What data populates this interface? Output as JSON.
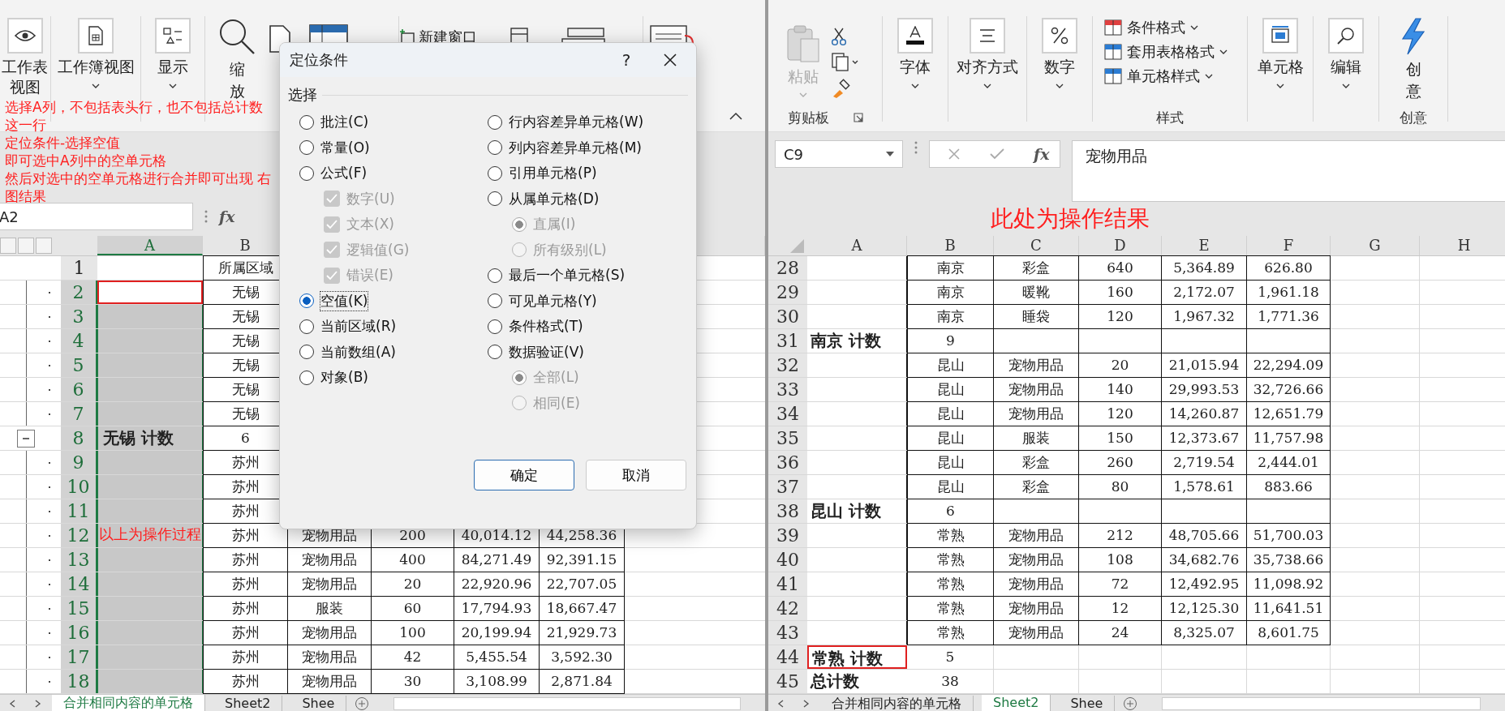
{
  "left_pane": {
    "ribbon": {
      "sheet_view": "工作表视图",
      "workbook_view": "工作簿视图",
      "show": "显示",
      "zoom": "缩放",
      "new_window": "新建窗口"
    },
    "name_box": "A2",
    "fx": "fx",
    "sheet": {
      "columns": [
        "A",
        "B"
      ],
      "rows": [
        {
          "number": "1",
          "kind": "header",
          "selected": false,
          "outlined": false,
          "cells": [
            "",
            "所属区域"
          ]
        },
        {
          "number": "2",
          "kind": "data",
          "selected": true,
          "outlined": true,
          "cells": [
            "",
            "无锡"
          ]
        },
        {
          "number": "3",
          "kind": "data",
          "selected": true,
          "outlined": false,
          "cells": [
            "",
            "无锡"
          ]
        },
        {
          "number": "4",
          "kind": "data",
          "selected": true,
          "outlined": false,
          "cells": [
            "",
            "无锡"
          ]
        },
        {
          "number": "5",
          "kind": "data",
          "selected": true,
          "outlined": false,
          "cells": [
            "",
            "无锡"
          ]
        },
        {
          "number": "6",
          "kind": "data",
          "selected": true,
          "outlined": false,
          "cells": [
            "",
            "无锡"
          ]
        },
        {
          "number": "7",
          "kind": "data",
          "selected": true,
          "outlined": false,
          "cells": [
            "",
            "无锡"
          ]
        },
        {
          "number": "8",
          "kind": "subtotal",
          "selected": true,
          "outlined": false,
          "cells": [
            "无锡 计数",
            "6"
          ]
        },
        {
          "number": "9",
          "kind": "data",
          "selected": true,
          "outlined": false,
          "cells": [
            "",
            "苏州"
          ]
        },
        {
          "number": "10",
          "kind": "data",
          "selected": true,
          "outlined": false,
          "cells": [
            "",
            "苏州"
          ]
        },
        {
          "number": "11",
          "kind": "data",
          "selected": true,
          "outlined": false,
          "cells": [
            "",
            "苏州"
          ]
        },
        {
          "number": "12",
          "kind": "data",
          "selected": true,
          "outlined": false,
          "cells": [
            "",
            "苏州",
            "宠物用品",
            "200",
            "40,014.12",
            "44,258.36"
          ]
        },
        {
          "number": "13",
          "kind": "data",
          "selected": true,
          "outlined": false,
          "cells": [
            "",
            "苏州",
            "宠物用品",
            "400",
            "84,271.49",
            "92,391.15"
          ]
        },
        {
          "number": "14",
          "kind": "data",
          "selected": true,
          "outlined": false,
          "cells": [
            "",
            "苏州",
            "宠物用品",
            "20",
            "22,920.96",
            "22,707.05"
          ]
        },
        {
          "number": "15",
          "kind": "data",
          "selected": true,
          "outlined": false,
          "cells": [
            "",
            "苏州",
            "服装",
            "60",
            "17,794.93",
            "18,667.47"
          ]
        },
        {
          "number": "16",
          "kind": "data",
          "selected": true,
          "outlined": false,
          "cells": [
            "",
            "苏州",
            "宠物用品",
            "100",
            "20,199.94",
            "21,929.73"
          ]
        },
        {
          "number": "17",
          "kind": "data",
          "selected": true,
          "outlined": false,
          "cells": [
            "",
            "苏州",
            "宠物用品",
            "42",
            "5,455.54",
            "3,592.30"
          ]
        },
        {
          "number": "18",
          "kind": "data",
          "selected": true,
          "outlined": false,
          "cells": [
            "",
            "苏州",
            "宠物用品",
            "30",
            "3,108.99",
            "2,871.84"
          ]
        }
      ]
    },
    "sheet_tabs": [
      {
        "label": "合并相同内容的单元格",
        "selected": true
      },
      {
        "label": "Sheet2",
        "selected": false
      },
      {
        "label": "Shee",
        "selected": false
      }
    ]
  },
  "right_pane": {
    "ribbon": {
      "paste": "粘贴",
      "clipboard_group": "剪贴板",
      "font": "字体",
      "alignment": "对齐方式",
      "number": "数字",
      "styles": [
        "条件格式",
        "套用表格格式",
        "单元格样式"
      ],
      "styles_group": "样式",
      "cells": "单元格",
      "editing": "编辑",
      "ideas": "创意",
      "ideas_group": "创意"
    },
    "name_box": "C9",
    "fx": "fx",
    "formula": "宠物用品",
    "sheet": {
      "columns": [
        "A",
        "B",
        "C",
        "D",
        "E",
        "F",
        "G",
        "H"
      ],
      "rows": [
        {
          "number": "28",
          "kind": "data",
          "in_table": true,
          "outlined": false,
          "cells": [
            "",
            "南京",
            "彩盒",
            "640",
            "5,364.89",
            "626.80"
          ]
        },
        {
          "number": "29",
          "kind": "data",
          "in_table": true,
          "outlined": false,
          "cells": [
            "",
            "南京",
            "暖靴",
            "160",
            "2,172.07",
            "1,961.18"
          ]
        },
        {
          "number": "30",
          "kind": "data",
          "in_table": true,
          "outlined": false,
          "cells": [
            "",
            "南京",
            "睡袋",
            "120",
            "1,967.32",
            "1,771.36"
          ]
        },
        {
          "number": "31",
          "kind": "subtotal",
          "in_table": true,
          "outlined": false,
          "cells": [
            "南京 计数",
            "9",
            "",
            "",
            "",
            ""
          ]
        },
        {
          "number": "32",
          "kind": "data",
          "in_table": true,
          "outlined": false,
          "cells": [
            "",
            "昆山",
            "宠物用品",
            "20",
            "21,015.94",
            "22,294.09"
          ]
        },
        {
          "number": "33",
          "kind": "data",
          "in_table": true,
          "outlined": false,
          "cells": [
            "",
            "昆山",
            "宠物用品",
            "140",
            "29,993.53",
            "32,726.66"
          ]
        },
        {
          "number": "34",
          "kind": "data",
          "in_table": true,
          "outlined": false,
          "cells": [
            "",
            "昆山",
            "宠物用品",
            "120",
            "14,260.87",
            "12,651.79"
          ]
        },
        {
          "number": "35",
          "kind": "data",
          "in_table": true,
          "outlined": false,
          "cells": [
            "",
            "昆山",
            "服装",
            "150",
            "12,373.67",
            "11,757.98"
          ]
        },
        {
          "number": "36",
          "kind": "data",
          "in_table": true,
          "outlined": false,
          "cells": [
            "",
            "昆山",
            "彩盒",
            "260",
            "2,719.54",
            "2,444.01"
          ]
        },
        {
          "number": "37",
          "kind": "data",
          "in_table": true,
          "outlined": false,
          "cells": [
            "",
            "昆山",
            "彩盒",
            "80",
            "1,578.61",
            "883.66"
          ]
        },
        {
          "number": "38",
          "kind": "subtotal",
          "in_table": true,
          "outlined": false,
          "cells": [
            "昆山 计数",
            "6",
            "",
            "",
            "",
            ""
          ]
        },
        {
          "number": "39",
          "kind": "data",
          "in_table": true,
          "outlined": false,
          "cells": [
            "",
            "常熟",
            "宠物用品",
            "212",
            "48,705.66",
            "51,700.03"
          ]
        },
        {
          "number": "40",
          "kind": "data",
          "in_table": true,
          "outlined": false,
          "cells": [
            "",
            "常熟",
            "宠物用品",
            "108",
            "34,682.76",
            "35,738.66"
          ]
        },
        {
          "number": "41",
          "kind": "data",
          "in_table": true,
          "outlined": false,
          "cells": [
            "",
            "常熟",
            "宠物用品",
            "72",
            "12,492.95",
            "11,098.92"
          ]
        },
        {
          "number": "42",
          "kind": "data",
          "in_table": true,
          "outlined": false,
          "cells": [
            "",
            "常熟",
            "宠物用品",
            "12",
            "12,125.30",
            "11,641.51"
          ]
        },
        {
          "number": "43",
          "kind": "data",
          "in_table": true,
          "outlined": false,
          "cells": [
            "",
            "常熟",
            "宠物用品",
            "24",
            "8,325.07",
            "8,601.75"
          ]
        },
        {
          "number": "44",
          "kind": "subtotal",
          "in_table": false,
          "outlined": true,
          "cells": [
            "常熟 计数",
            "5"
          ]
        },
        {
          "number": "45",
          "kind": "subtotal",
          "in_table": false,
          "outlined": false,
          "cells": [
            "总计数",
            "38"
          ]
        }
      ]
    },
    "sheet_tabs": [
      {
        "label": "合并相同内容的单元格",
        "selected": false
      },
      {
        "label": "Sheet2",
        "selected": true
      },
      {
        "label": "Shee",
        "selected": false
      }
    ]
  },
  "dialog": {
    "title": "定位条件",
    "help": "?",
    "section": "选择",
    "options_left": [
      {
        "kind": "radio",
        "label": "批注(C)",
        "selected": false,
        "disabled": false
      },
      {
        "kind": "radio",
        "label": "常量(O)",
        "selected": false,
        "disabled": false
      },
      {
        "kind": "radio",
        "label": "公式(F)",
        "selected": false,
        "disabled": false,
        "children": [
          {
            "kind": "checkbox",
            "label": "数字(U)",
            "checked": true,
            "disabled": true
          },
          {
            "kind": "checkbox",
            "label": "文本(X)",
            "checked": true,
            "disabled": true
          },
          {
            "kind": "checkbox",
            "label": "逻辑值(G)",
            "checked": true,
            "disabled": true
          },
          {
            "kind": "checkbox",
            "label": "错误(E)",
            "checked": true,
            "disabled": true
          }
        ]
      },
      {
        "kind": "radio",
        "label": "空值(K)",
        "selected": true,
        "disabled": false
      },
      {
        "kind": "radio",
        "label": "当前区域(R)",
        "selected": false,
        "disabled": false
      },
      {
        "kind": "radio",
        "label": "当前数组(A)",
        "selected": false,
        "disabled": false
      },
      {
        "kind": "radio",
        "label": "对象(B)",
        "selected": false,
        "disabled": false
      }
    ],
    "options_right": [
      {
        "kind": "radio",
        "label": "行内容差异单元格(W)",
        "selected": false,
        "disabled": false
      },
      {
        "kind": "radio",
        "label": "列内容差异单元格(M)",
        "selected": false,
        "disabled": false
      },
      {
        "kind": "radio",
        "label": "引用单元格(P)",
        "selected": false,
        "disabled": false
      },
      {
        "kind": "radio",
        "label": "从属单元格(D)",
        "selected": false,
        "disabled": false,
        "children": [
          {
            "kind": "radio",
            "label": "直属(I)",
            "selected": true,
            "disabled": true
          },
          {
            "kind": "radio",
            "label": "所有级别(L)",
            "selected": false,
            "disabled": true
          }
        ]
      },
      {
        "kind": "radio",
        "label": "最后一个单元格(S)",
        "selected": false,
        "disabled": false
      },
      {
        "kind": "radio",
        "label": "可见单元格(Y)",
        "selected": false,
        "disabled": false
      },
      {
        "kind": "radio",
        "label": "条件格式(T)",
        "selected": false,
        "disabled": false
      },
      {
        "kind": "radio",
        "label": "数据验证(V)",
        "selected": false,
        "disabled": false,
        "children": [
          {
            "kind": "radio",
            "label": "全部(L)",
            "selected": true,
            "disabled": true
          },
          {
            "kind": "radio",
            "label": "相同(E)",
            "selected": false,
            "disabled": true
          }
        ]
      }
    ],
    "buttons": [
      {
        "label": "确定",
        "default": true
      },
      {
        "label": "取消",
        "default": false
      }
    ]
  },
  "annotations": {
    "steps": [
      "选择A列，不包括表头行，也不包括总计数这一行",
      "定位条件-选择空值",
      "即可选中A列中的空单元格",
      "然后对选中的空单元格进行合并即可出现 右图结果"
    ],
    "process_note": "以上为操作过程",
    "result_note": "此处为操作结果"
  }
}
